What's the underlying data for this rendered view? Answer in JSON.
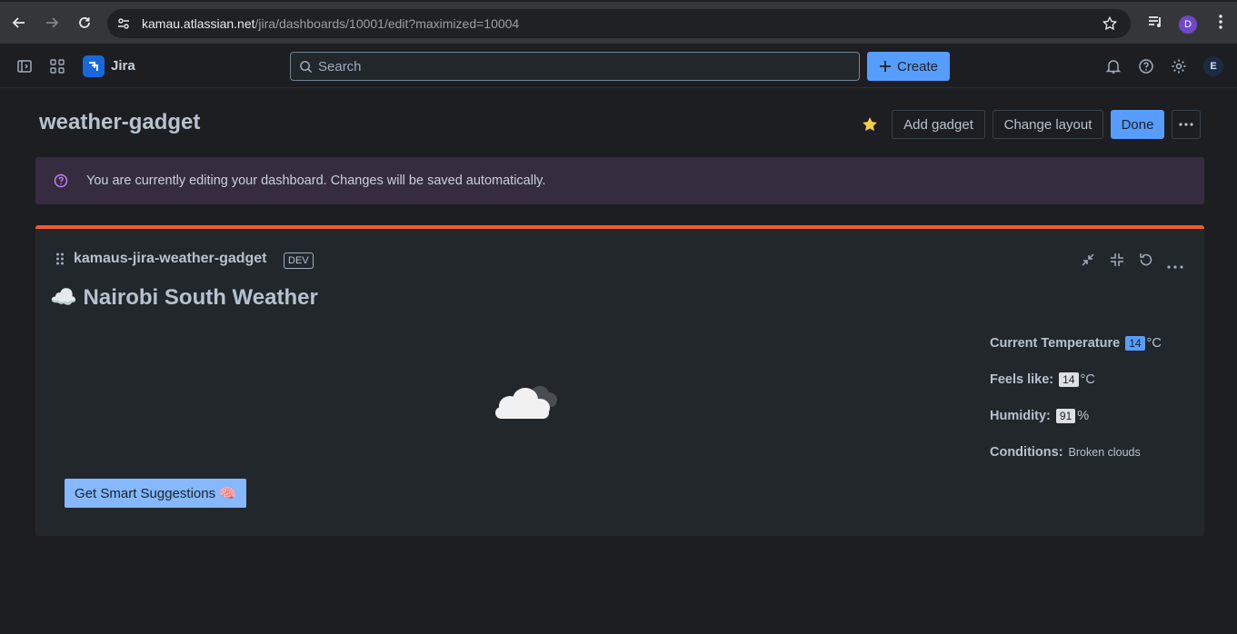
{
  "browser": {
    "url_host": "kamau.atlassian.net",
    "url_path": "/jira/dashboards/10001/edit?maximized=10004",
    "profile_initial": "D"
  },
  "topnav": {
    "app_name": "Jira",
    "search_placeholder": "Search",
    "create_label": "Create",
    "avatar_initial": "E"
  },
  "page": {
    "title": "weather-gadget",
    "add_gadget_label": "Add gadget",
    "change_layout_label": "Change layout",
    "done_label": "Done"
  },
  "banner": {
    "text": "You are currently editing your dashboard. Changes will be saved automatically."
  },
  "gadget": {
    "title": "kamaus-jira-weather-gadget",
    "badge": "DEV",
    "weather_title": "☁️ Nairobi South Weather",
    "current_temp_label": "Current Temperature",
    "current_temp_value": "14",
    "temp_unit": "°C",
    "feels_like_label": "Feels like:",
    "feels_like_value": "14",
    "humidity_label": "Humidity:",
    "humidity_value": "91",
    "humidity_unit": "%",
    "conditions_label": "Conditions:",
    "conditions_value": "Broken clouds",
    "suggest_label": "Get Smart Suggestions 🧠"
  },
  "colors": {
    "accent_blue": "#579dff",
    "gadget_top_border": "#f15b2b",
    "banner_bg": "#352c3f"
  }
}
